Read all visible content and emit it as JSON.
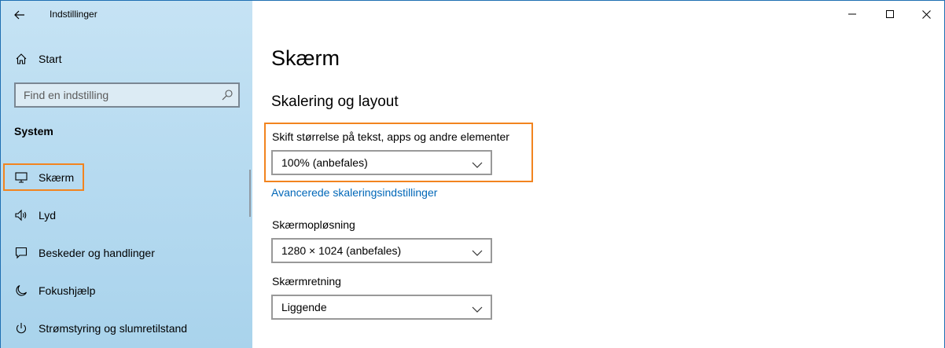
{
  "window": {
    "title": "Indstillinger"
  },
  "sidebar": {
    "home_label": "Start",
    "search": {
      "placeholder": "Find en indstilling"
    },
    "section": "System",
    "items": [
      {
        "label": "Skærm",
        "icon": "monitor-icon"
      },
      {
        "label": "Lyd",
        "icon": "speaker-icon"
      },
      {
        "label": "Beskeder og handlinger",
        "icon": "message-icon"
      },
      {
        "label": "Fokushjælp",
        "icon": "moon-icon"
      },
      {
        "label": "Strømstyring og slumretilstand",
        "icon": "power-icon"
      }
    ]
  },
  "main": {
    "title": "Skærm",
    "subtitle": "Skalering og layout",
    "scale": {
      "label": "Skift størrelse på tekst, apps og andre elementer",
      "value": "100% (anbefales)"
    },
    "advanced_link": "Avancerede skaleringsindstillinger",
    "resolution": {
      "label": "Skærmopløsning",
      "value": "1280 × 1024 (anbefales)"
    },
    "orientation": {
      "label": "Skærmretning",
      "value": "Liggende"
    }
  },
  "colors": {
    "highlight": "#f2841f",
    "link": "#0067b8",
    "sidebar_bg": "#b9dcf1"
  }
}
